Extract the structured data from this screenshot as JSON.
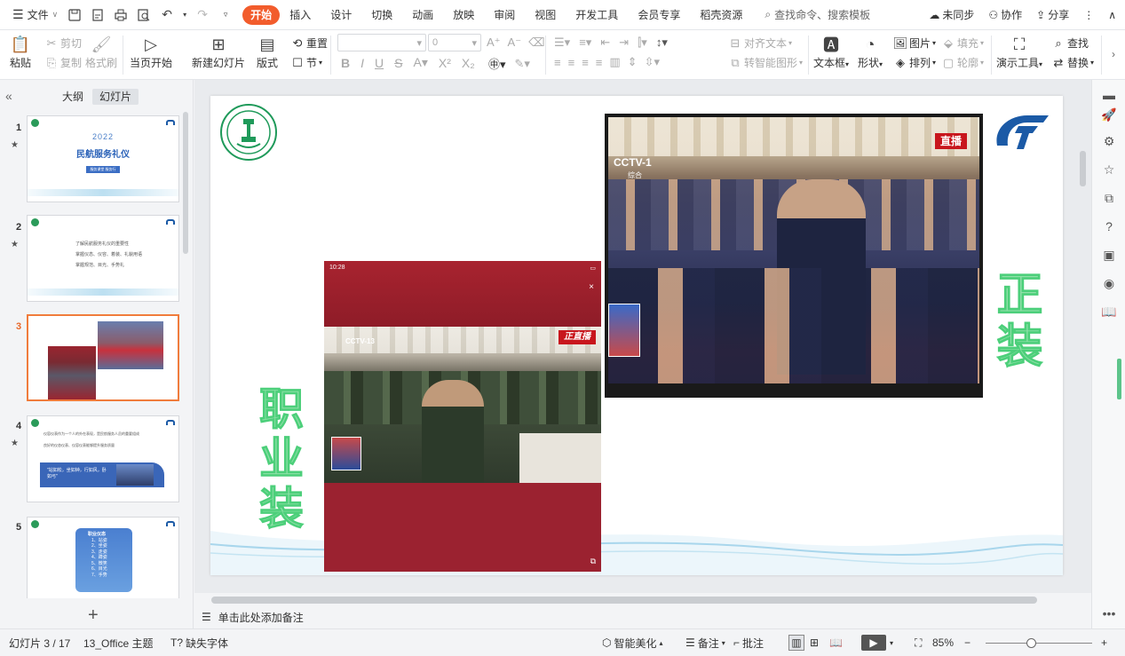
{
  "menubar": {
    "file_label": "文件",
    "tabs": [
      "开始",
      "插入",
      "设计",
      "切换",
      "动画",
      "放映",
      "审阅",
      "视图",
      "开发工具",
      "会员专享",
      "稻壳资源"
    ],
    "active_tab": "开始",
    "search_label": "查找命令、搜索模板",
    "sync_label": "未同步",
    "collab_label": "协作",
    "share_label": "分享"
  },
  "ribbon": {
    "paste": "粘贴",
    "cut": "剪切",
    "copy": "复制",
    "format_painter": "格式刷",
    "start_from_current": "当页开始",
    "new_slide": "新建幻灯片",
    "layout": "版式",
    "section": "节",
    "reset": "重置",
    "font_size": "0",
    "align_text": "对齐文本",
    "smart_shape": "转智能图形",
    "textbox": "文本框",
    "shape": "形状",
    "picture": "图片",
    "fill": "填充",
    "arrange": "排列",
    "outline": "轮廓",
    "presentation_tools": "演示工具",
    "find": "查找",
    "replace": "替换"
  },
  "leftpanel": {
    "outline_tab": "大纲",
    "slides_tab": "幻灯片",
    "slides": [
      {
        "num": "1",
        "year": "2022",
        "title": "民航服务礼仪",
        "btn": "服务课堂  服务行"
      },
      {
        "num": "2",
        "lines": [
          "了解民航服务礼仪的重要性",
          "掌握仪态、仪容、着装、礼貌用语",
          "掌握规范、目光、手势礼"
        ]
      },
      {
        "num": "3"
      },
      {
        "num": "4",
        "bullets": [
          "仪容仪表作为一个人的外在表现，是民航服务人员的重要组成",
          "良好的仪态仪表、仪容仪表能够提升服务质量"
        ],
        "quote": "\"站如松，坐如钟，行如风，卧如弓\""
      },
      {
        "num": "5",
        "box_title": "职业仪态",
        "items": [
          "1、站姿",
          "2、坐姿",
          "3、走姿",
          "4、蹲姿",
          "5、微笑",
          "6、目光",
          "7、手势"
        ]
      }
    ],
    "selected": 3
  },
  "slide": {
    "left_text": "职业装",
    "right_text": "正装",
    "left_photo": {
      "time": "10:28",
      "badge": "正直播",
      "cctv": "CCTV-13"
    },
    "right_photo": {
      "badge": "直播",
      "cctv": "CCTV-1",
      "sub": "综合"
    }
  },
  "notes_placeholder": "单击此处添加备注",
  "status": {
    "slide_counter": "幻灯片 3 / 17",
    "theme": "13_Office 主题",
    "missing_font": "缺失字体",
    "smart_beautify": "智能美化",
    "notes": "备注",
    "comments": "批注",
    "zoom": "85%"
  },
  "colors": {
    "accent": "#f25c2c",
    "selected_border": "#f07c3c",
    "slide_text_green": "#4ccf7a"
  }
}
